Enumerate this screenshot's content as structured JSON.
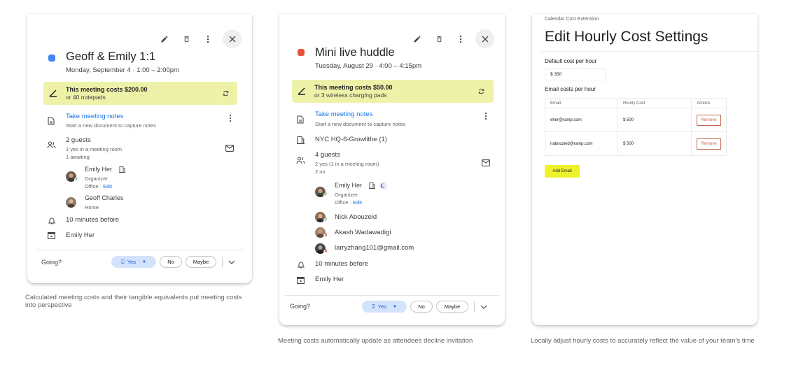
{
  "card1": {
    "color": "#4285f4",
    "title": "Geoff & Emily 1:1",
    "date": "Monday, September 4 · 1:00 – 2:00pm",
    "cost_line1": "This meeting costs $200.00",
    "cost_line2": "or 40 notepads",
    "notes_title": "Take meeting notes",
    "notes_sub": "Start a new document to capture notes",
    "guests_title": "2 guests",
    "guests_sub1": "1 yes in a meeting room",
    "guests_sub2": "1 awaiting",
    "guests": [
      {
        "name": "Emily Her",
        "line1": "Organizer",
        "line2": "Office · ",
        "edit": "Edit"
      },
      {
        "name": "Geoff Charles",
        "line1": "Home"
      }
    ],
    "reminder": "10 minutes before",
    "calendar_owner": "Emily Her",
    "going": "Going?",
    "yes": "Yes",
    "no": "No",
    "maybe": "Maybe"
  },
  "card2": {
    "color": "#e8543a",
    "title": "Mini live huddle",
    "date": "Tuesday, August 29 · 4:00 – 4:15pm",
    "cost_line1": "This meeting costs $50.00",
    "cost_line2": "or 3 wireless charging pads",
    "notes_title": "Take meeting notes",
    "notes_sub": "Start a new document to capture notes",
    "room": "NYC HQ-6-Growlithe (1)",
    "guests_title": "4 guests",
    "guests_sub1": "2 yes (1 in a meeting room)",
    "guests_sub2": "2 no",
    "guests": [
      {
        "name": "Emily Her",
        "line1": "Organizer",
        "line2": "Office · ",
        "edit": "Edit"
      },
      {
        "name": "Nick Abouzeid"
      },
      {
        "name": "Akash Wadawadigi"
      },
      {
        "name": "larryzhang101@gmail.com"
      }
    ],
    "reminder": "10 minutes before",
    "calendar_owner": "Emily Her",
    "going": "Going?",
    "yes": "Yes",
    "no": "No",
    "maybe": "Maybe"
  },
  "card3": {
    "extension_name": "Calendar Cost Extension",
    "title": "Edit Hourly Cost Settings",
    "default_label": "Default cost per hour",
    "default_value": "$ 350",
    "email_label": "Email costs per hour",
    "columns": [
      "Email",
      "Hourly Cost",
      "Actions"
    ],
    "rows": [
      {
        "email": "eher@ramp.com",
        "cost": "$ 500",
        "action": "Remove"
      },
      {
        "email": "nabouzeid@ramp.com",
        "cost": "$ 500",
        "action": "Remove"
      }
    ],
    "add_button": "Add Email"
  },
  "captions": {
    "c1": "Calculated meeting costs and their tangible equivalents put meeting costs into perspective",
    "c2": "Meeting costs automatically update as attendees decline invitation",
    "c3": "Locally adjust hourly costs to accurately reflect the value of your team's time"
  },
  "colors": {
    "cost_highlight": "#eef2a8",
    "accent_blue": "#1a73e8",
    "yes_green": "#188038",
    "no_red": "#d93025",
    "add_button": "#eef22a",
    "remove_button": "#c0684a"
  }
}
